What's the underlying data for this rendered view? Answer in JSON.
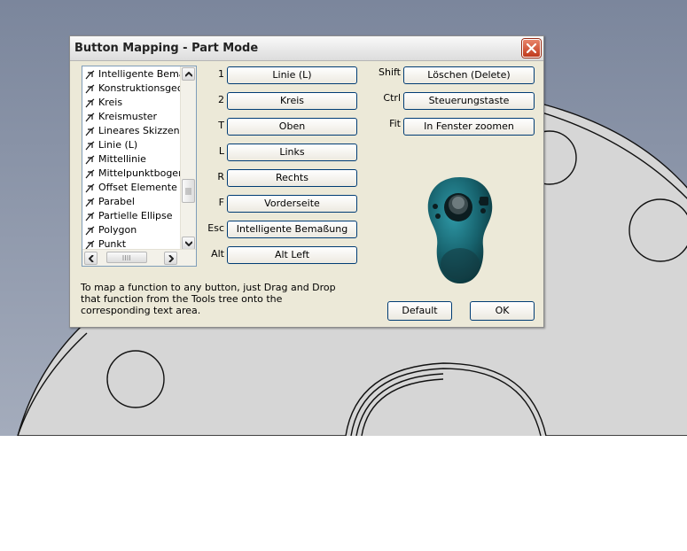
{
  "window": {
    "title": "Button Mapping - Part Mode"
  },
  "icons": {
    "close": "close-x-icon",
    "tree_item": "sketch-tool-icon",
    "device": "spacemouse-device-icon"
  },
  "colors": {
    "background_viewport": "#8a94a8",
    "part_gray": "#d6d6d6",
    "dialog_face": "#ece9d8",
    "button_border": "#003c74",
    "close_red": "#d4492c"
  },
  "tools_tree": {
    "items": [
      "Intelligente Bemaßung",
      "Konstruktionsgeometrie",
      "Kreis",
      "Kreismuster",
      "Lineares Skizzenmuster",
      "Linie   (L)",
      "Mittellinie",
      "Mittelpunktbogen",
      "Offset Elemente",
      "Parabel",
      "Partielle Ellipse",
      "Polygon",
      "Punkt"
    ]
  },
  "left_mappings": [
    {
      "key": "1",
      "action": "Linie   (L)"
    },
    {
      "key": "2",
      "action": "Kreis"
    },
    {
      "key": "T",
      "action": "Oben"
    },
    {
      "key": "L",
      "action": "Links"
    },
    {
      "key": "R",
      "action": "Rechts"
    },
    {
      "key": "F",
      "action": "Vorderseite"
    },
    {
      "key": "Esc",
      "action": "Intelligente Bemaßung"
    },
    {
      "key": "Alt",
      "action": "Alt Left"
    }
  ],
  "right_mappings": [
    {
      "key": "Shift",
      "action": "Löschen   (Delete)"
    },
    {
      "key": "Ctrl",
      "action": "Steuerungstaste"
    },
    {
      "key": "Fit",
      "action": "In Fenster zoomen"
    }
  ],
  "instructions": "To map a function to any button, just Drag and Drop that function from the Tools tree onto the corresponding text area.",
  "footer": {
    "default_label": "Default",
    "ok_label": "OK"
  }
}
